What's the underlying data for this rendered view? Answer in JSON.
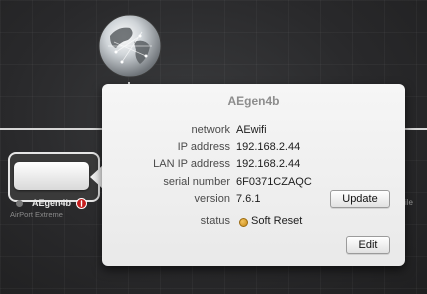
{
  "popover": {
    "title": "AEgen4b",
    "rows": [
      {
        "label": "network",
        "value": "AEwifi"
      },
      {
        "label": "IP address",
        "value": "192.168.2.44"
      },
      {
        "label": "LAN IP address",
        "value": "192.168.2.44"
      },
      {
        "label": "serial number",
        "value": "6F0371CZAQC"
      },
      {
        "label": "version",
        "value": "7.6.1"
      }
    ],
    "status_label": "status",
    "status_value": "Soft Reset",
    "update_button": "Update",
    "edit_button": "Edit"
  },
  "device": {
    "name": "AEgen4b",
    "model": "AirPort Extreme"
  },
  "background": {
    "side_text": "ile"
  },
  "icons": {
    "globe": "globe-icon",
    "status": "status-dot-icon",
    "warning": "warning-icon"
  },
  "colors": {
    "status_amber": "#e0a83a",
    "warning_red": "#c51f1f"
  }
}
